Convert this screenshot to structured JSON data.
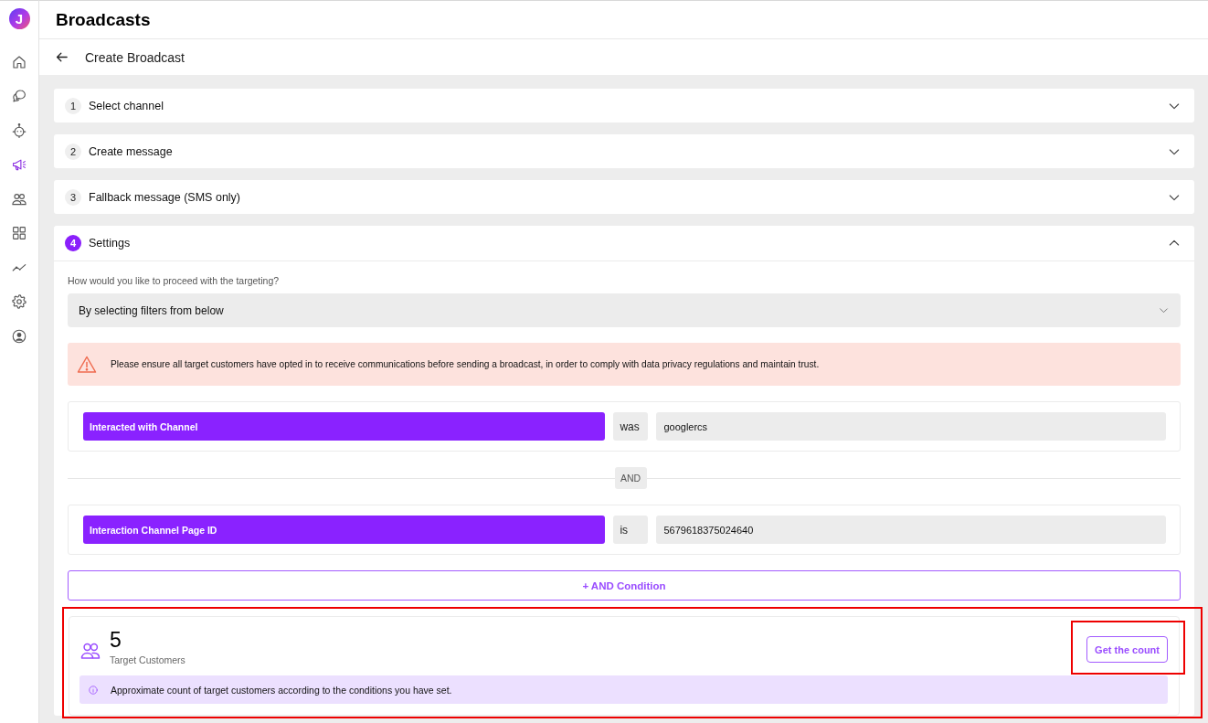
{
  "logo": "J",
  "sidebar": {
    "items": [
      {
        "selected": false
      },
      {
        "selected": false
      },
      {
        "selected": false
      },
      {
        "selected": true
      },
      {
        "selected": false
      },
      {
        "selected": false
      },
      {
        "selected": false
      },
      {
        "selected": false
      },
      {
        "selected": false
      }
    ]
  },
  "header": {
    "title": "Broadcasts"
  },
  "subheader": {
    "title": "Create Broadcast"
  },
  "steps": [
    {
      "number": "1",
      "title": "Select channel",
      "expanded": false
    },
    {
      "number": "2",
      "title": "Create message",
      "expanded": false
    },
    {
      "number": "3",
      "title": "Fallback message (SMS only)",
      "expanded": false
    },
    {
      "number": "4",
      "title": "Settings",
      "expanded": true,
      "content": {
        "question": "How would you like to proceed with the targeting?",
        "targeting_select": {
          "value": "By selecting filters from below"
        },
        "alert": "Please ensure all target customers have opted in to receive communications before sending a broadcast, in order to comply with data privacy regulations and maintain trust.",
        "conditions": [
          {
            "field": "Interacted with Channel",
            "operator": "was",
            "value": "googlercs"
          },
          {
            "field": "Interaction Channel Page ID",
            "operator": "is",
            "value": "5679618375024640"
          }
        ],
        "connector": "AND",
        "add_button": "+ AND Condition",
        "count_panel": {
          "count": "5",
          "label": "Target Customers",
          "button": "Get the count",
          "note": "Approximate count of target customers according to the conditions you have set.",
          "highlighted": true,
          "button_highlighted": true
        }
      }
    }
  ]
}
